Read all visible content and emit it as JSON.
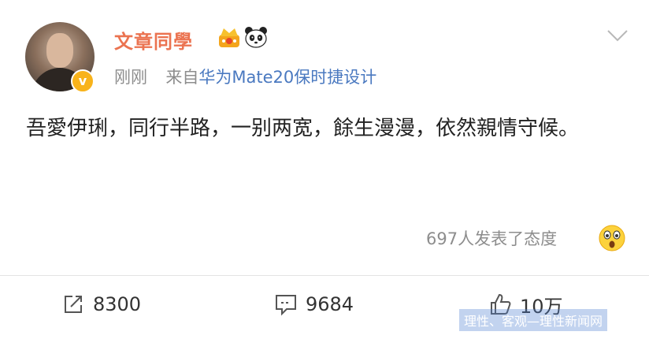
{
  "user": {
    "name": "文章同學",
    "time": "刚刚",
    "source_prefix": "来自",
    "source": "华为Mate20保时捷设计"
  },
  "post": {
    "text": "吾愛伊琍，同行半路，一别两宽，餘生漫漫，依然親情守候。"
  },
  "reactions": {
    "summary": "697人发表了态度"
  },
  "actions": {
    "repost_count": "8300",
    "comment_count": "9684",
    "like_count": "10万"
  },
  "watermark": "理性、客观—理性新闻网",
  "icons": {
    "verified": "verified-badge-icon",
    "crown": "crown-icon",
    "panda": "panda-icon",
    "menu": "chevron-down-icon",
    "emoji": "surprised-emoji-icon",
    "repost": "repost-icon",
    "comment": "comment-icon",
    "like": "thumbs-up-icon"
  },
  "colors": {
    "username": "#eb7350",
    "source_link": "#4a79c0",
    "verified": "#f8b31b"
  }
}
